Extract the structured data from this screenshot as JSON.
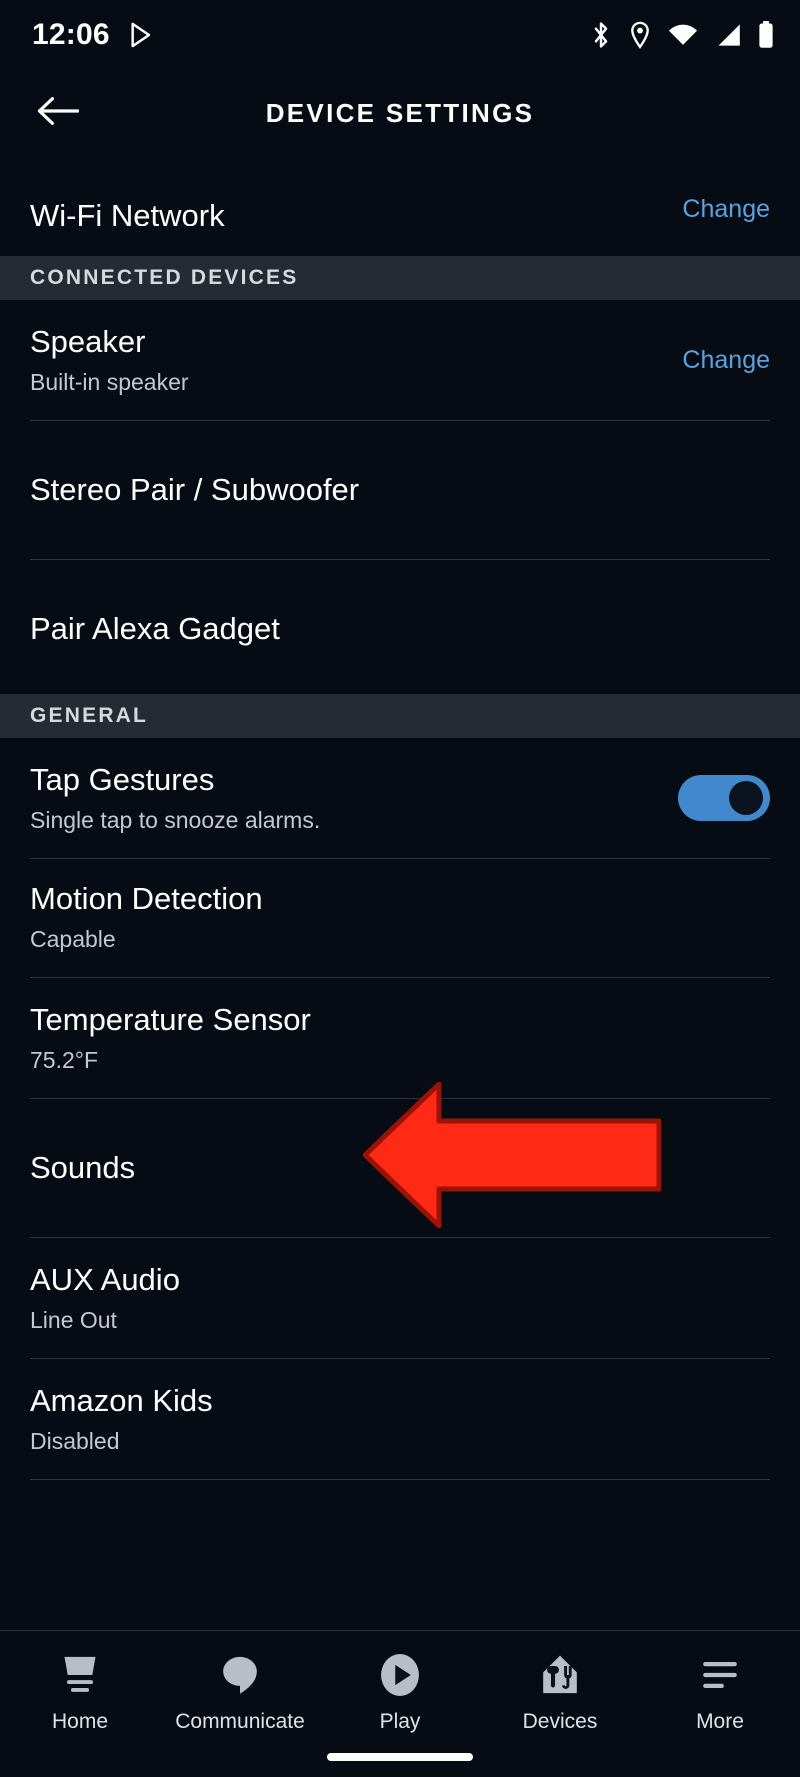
{
  "status_bar": {
    "time": "12:06",
    "left_icons": [
      "play-store-icon"
    ],
    "right_icons": [
      "bluetooth-icon",
      "location-icon",
      "wifi-icon",
      "cellular-signal-icon",
      "battery-icon"
    ]
  },
  "app_bar": {
    "back_icon": "back-arrow-icon",
    "title": "DEVICE SETTINGS"
  },
  "clipped_row": {
    "title": "Wi-Fi Network",
    "action": "Change"
  },
  "sections": [
    {
      "header": "CONNECTED DEVICES",
      "rows": [
        {
          "title": "Speaker",
          "subtitle": "Built-in speaker",
          "action": "Change"
        },
        {
          "title": "Stereo Pair / Subwoofer",
          "subtitle": "",
          "action": ""
        },
        {
          "title": "Pair Alexa Gadget",
          "subtitle": "",
          "action": ""
        }
      ]
    },
    {
      "header": "GENERAL",
      "rows": [
        {
          "title": "Tap Gestures",
          "subtitle": "Single tap to snooze alarms.",
          "action": "",
          "toggle": "on"
        },
        {
          "title": "Motion Detection",
          "subtitle": "Capable",
          "action": ""
        },
        {
          "title": "Temperature Sensor",
          "subtitle": "75.2°F",
          "action": ""
        },
        {
          "title": "Sounds",
          "subtitle": "",
          "action": ""
        },
        {
          "title": "AUX Audio",
          "subtitle": "Line Out",
          "action": ""
        },
        {
          "title": "Amazon Kids",
          "subtitle": "Disabled",
          "action": ""
        }
      ]
    }
  ],
  "annotation": {
    "shape": "left-pointing-arrow",
    "fill_color": "#FF2A15",
    "stroke_color": "#9B1206",
    "points_at": "Motion Detection"
  },
  "bottom_nav": [
    {
      "label": "Home",
      "icon": "home-icon"
    },
    {
      "label": "Communicate",
      "icon": "speech-bubble-icon"
    },
    {
      "label": "Play",
      "icon": "play-circle-icon"
    },
    {
      "label": "Devices",
      "icon": "devices-house-icon"
    },
    {
      "label": "More",
      "icon": "more-lines-icon"
    }
  ],
  "colors": {
    "background": "#070c14",
    "section_header_bg": "#252b33",
    "link_blue": "#5aa2e0",
    "toggle_on": "#4189cc",
    "divider": "#2b333d"
  }
}
